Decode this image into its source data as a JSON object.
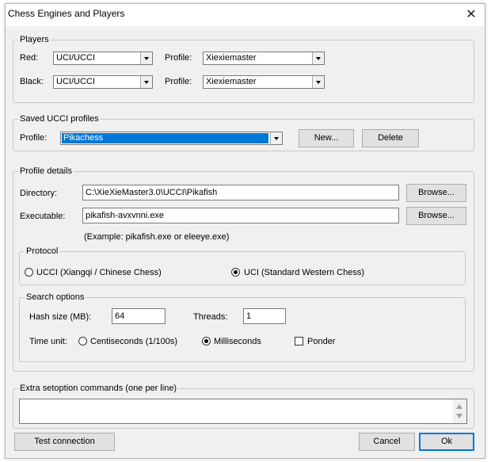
{
  "window": {
    "title": "Chess Engines and Players"
  },
  "players": {
    "group_label": "Players",
    "red_label": "Red:",
    "red_engine": "UCI/UCCI",
    "red_profile_label": "Profile:",
    "red_profile": "Xiexiemaster",
    "black_label": "Black:",
    "black_engine": "UCI/UCCI",
    "black_profile_label": "Profile:",
    "black_profile": "Xiexiemaster"
  },
  "saved_profiles": {
    "group_label": "Saved UCCI profiles",
    "profile_label": "Profile:",
    "profile_value": "Pikachess",
    "new_button": "New...",
    "delete_button": "Delete"
  },
  "profile_details": {
    "group_label": "Profile details",
    "directory_label": "Directory:",
    "directory_value": "C:\\XieXieMaster3.0\\UCCI\\Pikafish",
    "browse_dir_button": "Browse...",
    "executable_label": "Executable:",
    "executable_value": "pikafish-avxvnni.exe",
    "browse_exe_button": "Browse...",
    "example_text": "(Example: pikafish.exe  or  eleeye.exe)"
  },
  "protocol": {
    "group_label": "Protocol",
    "ucci_label": "UCCI  (Xiangqi / Chinese Chess)",
    "uci_label": "UCI  (Standard Western Chess)",
    "selected": "uci"
  },
  "search_options": {
    "group_label": "Search options",
    "hash_label": "Hash size (MB):",
    "hash_value": "64",
    "threads_label": "Threads:",
    "threads_value": "1",
    "time_unit_label": "Time unit:",
    "centiseconds_label": "Centiseconds (1/100s)",
    "milliseconds_label": "Milliseconds",
    "time_unit_selected": "milliseconds",
    "ponder_label": "Ponder",
    "ponder_checked": false
  },
  "extra": {
    "group_label": "Extra setoption commands (one per line)",
    "value": ""
  },
  "footer": {
    "test_button": "Test connection",
    "cancel_button": "Cancel",
    "ok_button": "Ok"
  },
  "colors": {
    "selection": "#0078d7",
    "dialog_bg": "#f0f0f0",
    "default_button_border": "#0078d7"
  }
}
